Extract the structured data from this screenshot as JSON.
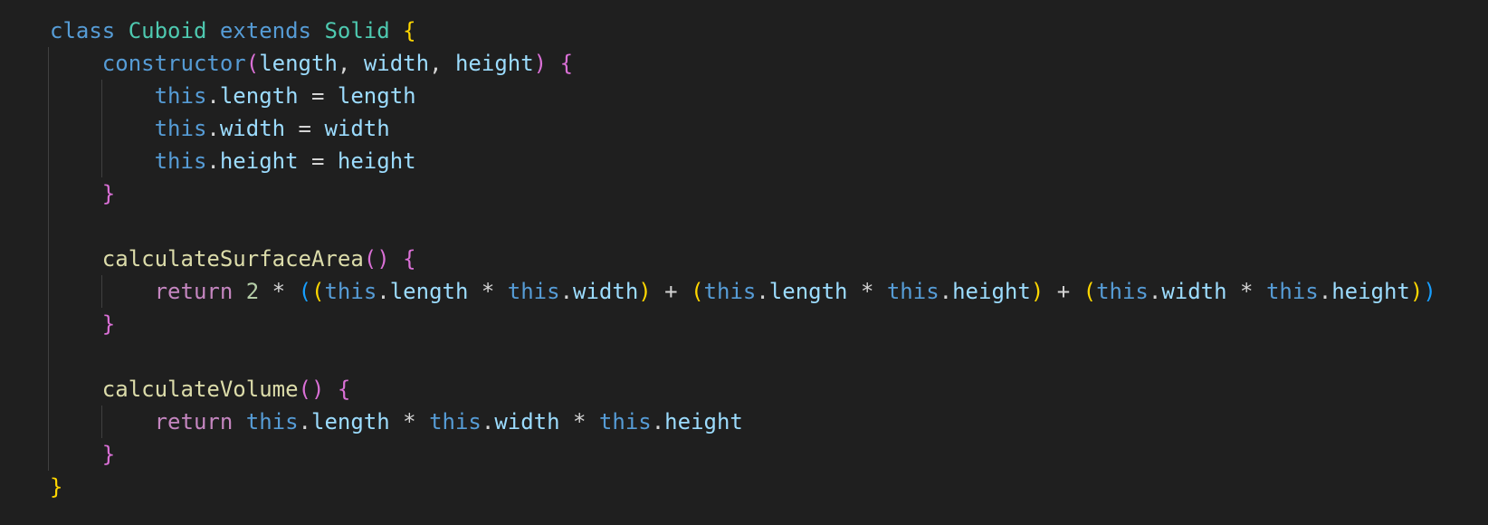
{
  "theme": {
    "background": "#1f1f1f",
    "keyword": "#569cd6",
    "class_name": "#4ec9b0",
    "function_name": "#dcdcaa",
    "variable": "#9cdcfe",
    "control_keyword": "#c586c0",
    "number": "#b5cea8",
    "bracket_level_1": "#ffd700",
    "bracket_level_2": "#da70d6",
    "bracket_level_3": "#179fff"
  },
  "code": {
    "language": "javascript",
    "lines": [
      [
        {
          "t": "class",
          "c": "kw"
        },
        {
          "t": " ",
          "c": "op"
        },
        {
          "t": "Cuboid",
          "c": "cls"
        },
        {
          "t": " ",
          "c": "op"
        },
        {
          "t": "extends",
          "c": "kw"
        },
        {
          "t": " ",
          "c": "op"
        },
        {
          "t": "Solid",
          "c": "cls"
        },
        {
          "t": " ",
          "c": "op"
        },
        {
          "t": "{",
          "c": "b1"
        }
      ],
      [
        {
          "t": "    ",
          "c": "op"
        },
        {
          "t": "constructor",
          "c": "kw"
        },
        {
          "t": "(",
          "c": "b2"
        },
        {
          "t": "length",
          "c": "param"
        },
        {
          "t": ", ",
          "c": "op"
        },
        {
          "t": "width",
          "c": "param"
        },
        {
          "t": ", ",
          "c": "op"
        },
        {
          "t": "height",
          "c": "param"
        },
        {
          "t": ")",
          "c": "b2"
        },
        {
          "t": " ",
          "c": "op"
        },
        {
          "t": "{",
          "c": "b2"
        }
      ],
      [
        {
          "t": "        ",
          "c": "op"
        },
        {
          "t": "this",
          "c": "kw"
        },
        {
          "t": ".",
          "c": "op"
        },
        {
          "t": "length",
          "c": "prop"
        },
        {
          "t": " = ",
          "c": "op"
        },
        {
          "t": "length",
          "c": "param"
        }
      ],
      [
        {
          "t": "        ",
          "c": "op"
        },
        {
          "t": "this",
          "c": "kw"
        },
        {
          "t": ".",
          "c": "op"
        },
        {
          "t": "width",
          "c": "prop"
        },
        {
          "t": " = ",
          "c": "op"
        },
        {
          "t": "width",
          "c": "param"
        }
      ],
      [
        {
          "t": "        ",
          "c": "op"
        },
        {
          "t": "this",
          "c": "kw"
        },
        {
          "t": ".",
          "c": "op"
        },
        {
          "t": "height",
          "c": "prop"
        },
        {
          "t": " = ",
          "c": "op"
        },
        {
          "t": "height",
          "c": "param"
        }
      ],
      [
        {
          "t": "    ",
          "c": "op"
        },
        {
          "t": "}",
          "c": "b2"
        }
      ],
      [],
      [
        {
          "t": "    ",
          "c": "op"
        },
        {
          "t": "calculateSurfaceArea",
          "c": "fn"
        },
        {
          "t": "()",
          "c": "b2"
        },
        {
          "t": " ",
          "c": "op"
        },
        {
          "t": "{",
          "c": "b2"
        }
      ],
      [
        {
          "t": "        ",
          "c": "op"
        },
        {
          "t": "return",
          "c": "ctl"
        },
        {
          "t": " ",
          "c": "op"
        },
        {
          "t": "2",
          "c": "num"
        },
        {
          "t": " * ",
          "c": "op"
        },
        {
          "t": "(",
          "c": "b3"
        },
        {
          "t": "(",
          "c": "b1"
        },
        {
          "t": "this",
          "c": "kw"
        },
        {
          "t": ".",
          "c": "op"
        },
        {
          "t": "length",
          "c": "prop"
        },
        {
          "t": " * ",
          "c": "op"
        },
        {
          "t": "this",
          "c": "kw"
        },
        {
          "t": ".",
          "c": "op"
        },
        {
          "t": "width",
          "c": "prop"
        },
        {
          "t": ")",
          "c": "b1"
        },
        {
          "t": " + ",
          "c": "op"
        },
        {
          "t": "(",
          "c": "b1"
        },
        {
          "t": "this",
          "c": "kw"
        },
        {
          "t": ".",
          "c": "op"
        },
        {
          "t": "length",
          "c": "prop"
        },
        {
          "t": " * ",
          "c": "op"
        },
        {
          "t": "this",
          "c": "kw"
        },
        {
          "t": ".",
          "c": "op"
        },
        {
          "t": "height",
          "c": "prop"
        },
        {
          "t": ")",
          "c": "b1"
        },
        {
          "t": " + ",
          "c": "op"
        },
        {
          "t": "(",
          "c": "b1"
        },
        {
          "t": "this",
          "c": "kw"
        },
        {
          "t": ".",
          "c": "op"
        },
        {
          "t": "width",
          "c": "prop"
        },
        {
          "t": " * ",
          "c": "op"
        },
        {
          "t": "this",
          "c": "kw"
        },
        {
          "t": ".",
          "c": "op"
        },
        {
          "t": "height",
          "c": "prop"
        },
        {
          "t": ")",
          "c": "b1"
        },
        {
          "t": ")",
          "c": "b3"
        }
      ],
      [
        {
          "t": "    ",
          "c": "op"
        },
        {
          "t": "}",
          "c": "b2"
        }
      ],
      [],
      [
        {
          "t": "    ",
          "c": "op"
        },
        {
          "t": "calculateVolume",
          "c": "fn"
        },
        {
          "t": "()",
          "c": "b2"
        },
        {
          "t": " ",
          "c": "op"
        },
        {
          "t": "{",
          "c": "b2"
        }
      ],
      [
        {
          "t": "        ",
          "c": "op"
        },
        {
          "t": "return",
          "c": "ctl"
        },
        {
          "t": " ",
          "c": "op"
        },
        {
          "t": "this",
          "c": "kw"
        },
        {
          "t": ".",
          "c": "op"
        },
        {
          "t": "length",
          "c": "prop"
        },
        {
          "t": " * ",
          "c": "op"
        },
        {
          "t": "this",
          "c": "kw"
        },
        {
          "t": ".",
          "c": "op"
        },
        {
          "t": "width",
          "c": "prop"
        },
        {
          "t": " * ",
          "c": "op"
        },
        {
          "t": "this",
          "c": "kw"
        },
        {
          "t": ".",
          "c": "op"
        },
        {
          "t": "height",
          "c": "prop"
        }
      ],
      [
        {
          "t": "    ",
          "c": "op"
        },
        {
          "t": "}",
          "c": "b2"
        }
      ],
      [
        {
          "t": "}",
          "c": "b1"
        }
      ]
    ]
  }
}
